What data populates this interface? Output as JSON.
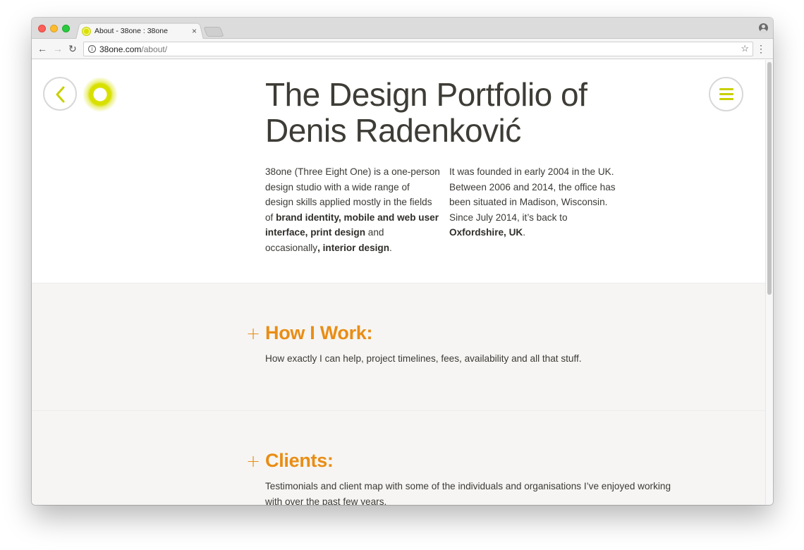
{
  "browser": {
    "tab_title": "About - 38one : 38one",
    "tab_close": "×",
    "url_host": "38one.com",
    "url_path": "/about/",
    "info_glyph": "i",
    "star_glyph": "☆",
    "menu_glyph": "⋮",
    "back_glyph": "←",
    "forward_glyph": "→",
    "reload_glyph": "↻"
  },
  "colors": {
    "accent_yellow": "#c8d000",
    "accent_orange": "#e98d15",
    "text": "#3b3a36",
    "section_bg": "#f6f5f3"
  },
  "hero": {
    "title_line1": "The Design Portfolio of",
    "title_line2": "Denis Radenković",
    "left_intro": "38one (Three Eight One) is a one-person design studio with a wide range of design skills applied mostly in the fields of ",
    "left_bold1": "brand identity, mobile and web user interface, print design",
    "left_mid": " and occasionally",
    "left_bold2": ", interior design",
    "left_end": ".",
    "right_intro": "It was founded in early 2004 in the UK. Between 2006 and 2014, the office has been situated in Madison, Wisconsin. Since July 2014, it’s back to ",
    "right_bold": "Oxfordshire, UK",
    "right_end": "."
  },
  "sections": {
    "work": {
      "plus": "+",
      "heading": "How I Work:",
      "text": "How exactly I can help, project timelines, fees, availability and all that stuff."
    },
    "clients": {
      "plus": "+",
      "heading": "Clients:",
      "text": "Testimonials and client map with some of the individuals and organisations I’ve enjoyed working with over the past few years."
    }
  }
}
